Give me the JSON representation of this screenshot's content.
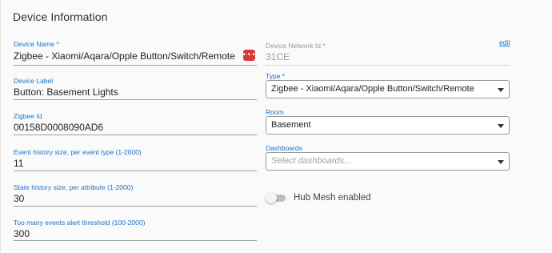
{
  "section": {
    "title": "Device Information"
  },
  "left_fields": {
    "device_name": {
      "label": "Device Name *",
      "value": "Zigbee - Xiaomi/Aqara/Opple Button/Switch/Remote",
      "menu_icon": "ellipsis-icon",
      "menu_color": "#d93838"
    },
    "device_label": {
      "label": "Device Label",
      "value": "Button: Basement Lights"
    },
    "zigbee_id": {
      "label": "Zigbee Id",
      "value": "00158D0008090AD6"
    },
    "event_history": {
      "label": "Event history size, per event type (1-2000)",
      "value": "11"
    },
    "state_history": {
      "label": "State history size, per attribute (1-2000)",
      "value": "30"
    },
    "alert_threshold": {
      "label": "Too many events alert threshold (100-2000)",
      "value": "300"
    }
  },
  "right_fields": {
    "network_id": {
      "label": "Device Network Id *",
      "value": "31CE",
      "edit_label": "edit"
    },
    "type": {
      "label": "Type *",
      "value": "Zigbee - Xiaomi/Aqara/Opple Button/Switch/Remote"
    },
    "room": {
      "label": "Room",
      "value": "Basement"
    },
    "dashboards": {
      "label": "Dashboards",
      "placeholder": "Select dashboards..."
    },
    "hub_mesh": {
      "label": "Hub Mesh enabled",
      "enabled": false
    }
  },
  "colors": {
    "label_blue": "#1a73c8",
    "accent_red": "#d93838"
  }
}
